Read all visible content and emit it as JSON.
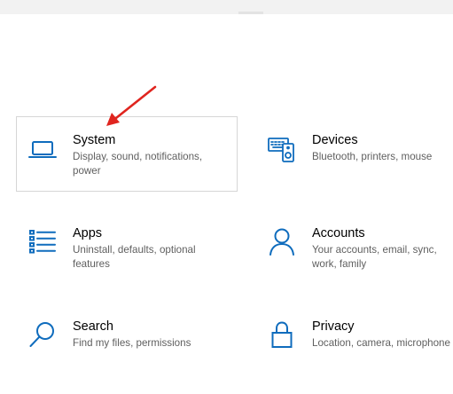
{
  "tiles": [
    {
      "id": "system",
      "title": "System",
      "description": "Display, sound, notifications, power",
      "icon": "laptop-icon",
      "selected": true
    },
    {
      "id": "devices",
      "title": "Devices",
      "description": "Bluetooth, printers, mouse",
      "icon": "devices-icon",
      "selected": false
    },
    {
      "id": "apps",
      "title": "Apps",
      "description": "Uninstall, defaults, optional features",
      "icon": "apps-list-icon",
      "selected": false
    },
    {
      "id": "accounts",
      "title": "Accounts",
      "description": "Your accounts, email, sync, work, family",
      "icon": "person-icon",
      "selected": false
    },
    {
      "id": "search",
      "title": "Search",
      "description": "Find my files, permissions",
      "icon": "magnifier-icon",
      "selected": false
    },
    {
      "id": "privacy",
      "title": "Privacy",
      "description": "Location, camera, microphone",
      "icon": "lock-icon",
      "selected": false
    }
  ],
  "colors": {
    "accent": "#0f6cbd",
    "annotation_arrow": "#e0251f",
    "tile_border": "#d6d6d6",
    "description_text": "#5f5f5f"
  }
}
